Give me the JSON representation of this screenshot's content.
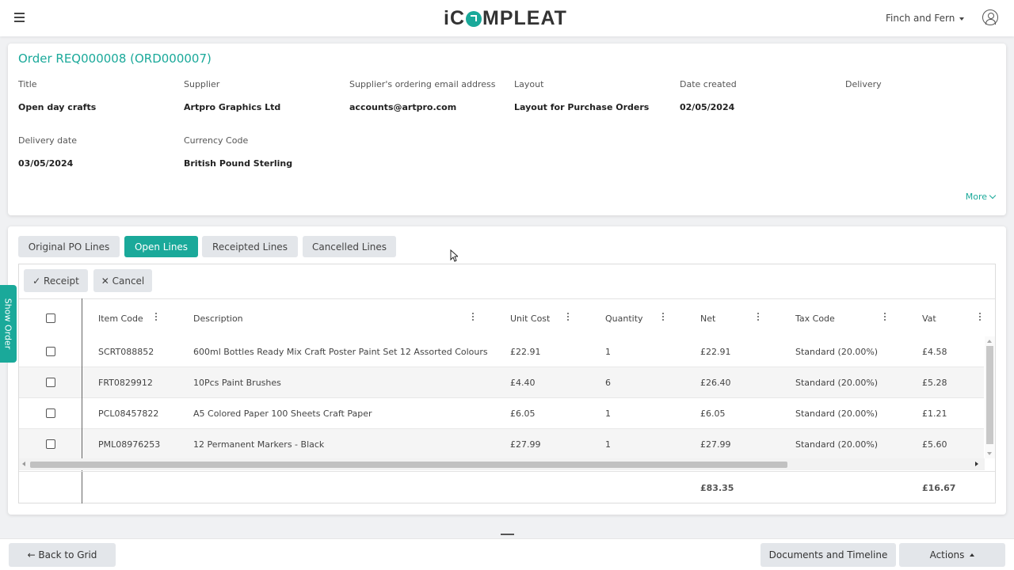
{
  "header": {
    "logo_text_left": "iC",
    "logo_text_right": "MPLEAT",
    "organization": "Finch and Fern"
  },
  "order": {
    "title": "Order REQ000008 (ORD000007)",
    "fields": [
      {
        "label": "Title",
        "value": "Open day crafts"
      },
      {
        "label": "Supplier",
        "value": "Artpro Graphics Ltd"
      },
      {
        "label": "Supplier's ordering email address",
        "value": "accounts@artpro.com"
      },
      {
        "label": "Layout",
        "value": "Layout for Purchase Orders"
      },
      {
        "label": "Date created",
        "value": "02/05/2024"
      },
      {
        "label": "Delivery",
        "value": ""
      },
      {
        "label": "Delivery date",
        "value": "03/05/2024"
      },
      {
        "label": "Currency Code",
        "value": "British Pound Sterling"
      }
    ],
    "more_label": "More"
  },
  "tabs": [
    "Original PO Lines",
    "Open Lines",
    "Receipted Lines",
    "Cancelled Lines"
  ],
  "active_tab": "Open Lines",
  "toolbar": {
    "receipt_label": "✓ Receipt",
    "cancel_label": "✕ Cancel"
  },
  "grid": {
    "columns": [
      "Item Code",
      "Description",
      "Unit Cost",
      "Quantity",
      "Net",
      "Tax Code",
      "Vat"
    ],
    "rows": [
      {
        "item_code": "SCRT088852",
        "description": "600ml Bottles Ready Mix Craft Poster Paint Set 12 Assorted Colours",
        "unit_cost": "£22.91",
        "quantity": "1",
        "net": "£22.91",
        "tax_code": "Standard (20.00%)",
        "vat": "£4.58"
      },
      {
        "item_code": "FRT0829912",
        "description": "10Pcs Paint Brushes",
        "unit_cost": "£4.40",
        "quantity": "6",
        "net": "£26.40",
        "tax_code": "Standard (20.00%)",
        "vat": "£5.28"
      },
      {
        "item_code": "PCL08457822",
        "description": "A5 Colored Paper 100 Sheets Craft Paper",
        "unit_cost": "£6.05",
        "quantity": "1",
        "net": "£6.05",
        "tax_code": "Standard (20.00%)",
        "vat": "£1.21"
      },
      {
        "item_code": "PML08976253",
        "description": "12 Permanent Markers - Black",
        "unit_cost": "£27.99",
        "quantity": "1",
        "net": "£27.99",
        "tax_code": "Standard (20.00%)",
        "vat": "£5.60"
      }
    ],
    "totals": {
      "net": "£83.35",
      "vat": "£16.67"
    }
  },
  "side_tab": "Show Order",
  "footer": {
    "back_label": "← Back to Grid",
    "documents_label": "Documents and Timeline",
    "actions_label": "Actions"
  },
  "colors": {
    "accent": "#1aa99a"
  },
  "icons": [
    "hamburger-icon",
    "logo-arrow-icon",
    "user-circle-icon",
    "caret-down-icon",
    "chevron-down-icon",
    "column-menu-icon",
    "caret-up-icon",
    "mouse-cursor-icon"
  ]
}
